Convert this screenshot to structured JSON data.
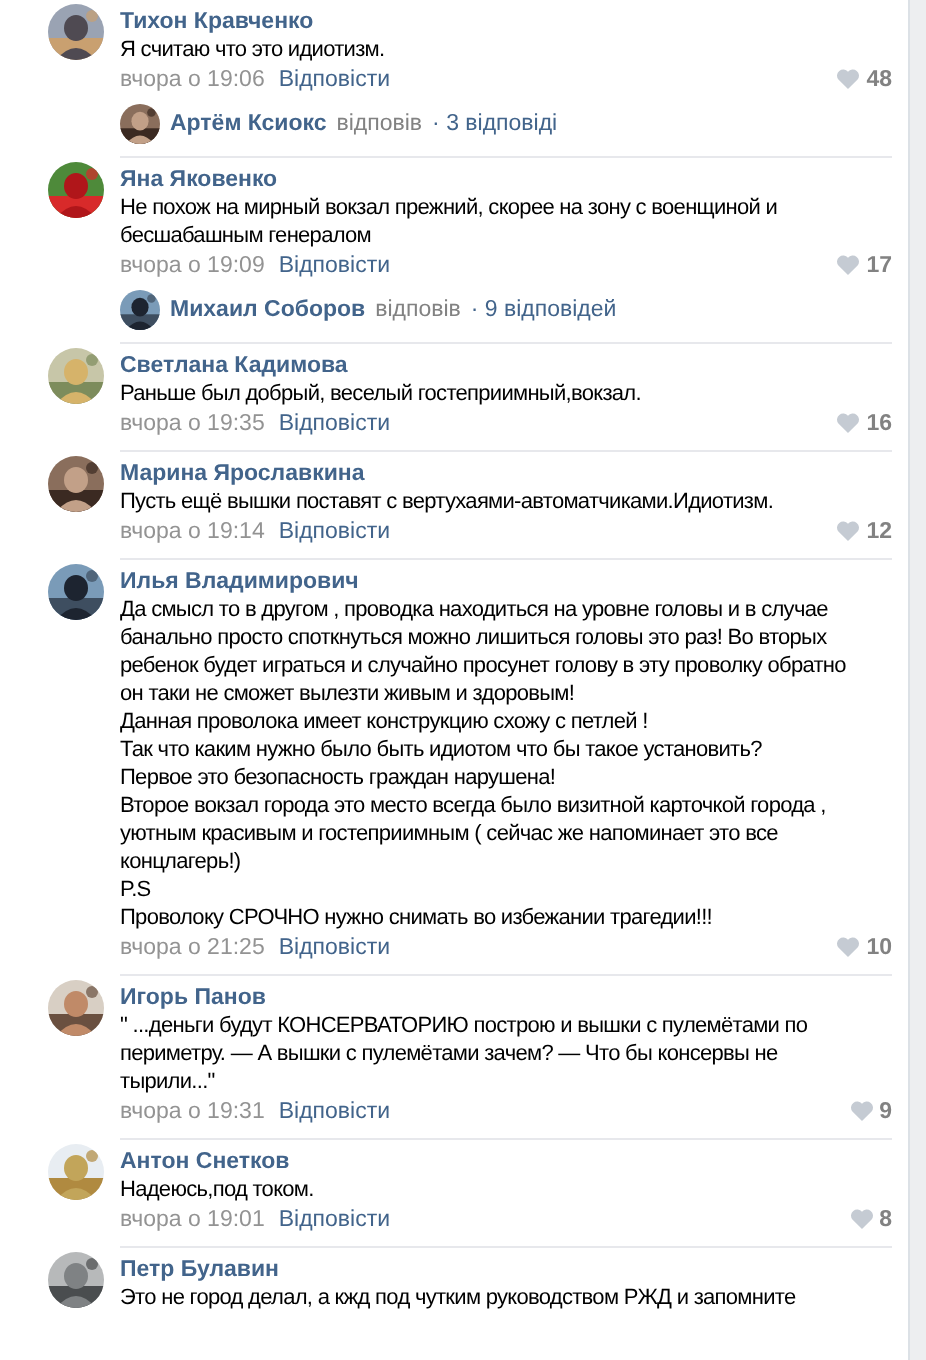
{
  "comments": [
    {
      "author": "Тихон Кравченко",
      "text": "Я считаю что это идиотизм.",
      "time": "вчора о 19:06",
      "reply": "Відповісти",
      "likes": "48",
      "thread": {
        "author": "Артём Ксиокс",
        "verb": "відповів",
        "count": "· 3 відповіді"
      }
    },
    {
      "author": "Яна Яковенко",
      "text": "Не похож на мирный вокзал прежний, скорее на зону с военщиной и\nбесшабашным генералом",
      "time": "вчора о 19:09",
      "reply": "Відповісти",
      "likes": "17",
      "thread": {
        "author": "Михаил Соборов",
        "verb": "відповів",
        "count": "· 9 відповідей"
      }
    },
    {
      "author": "Светлана Кадимова",
      "text": "Раньше был добрый, веселый гостеприимный,вокзал.",
      "time": "вчора о 19:35",
      "reply": "Відповісти",
      "likes": "16"
    },
    {
      "author": "Марина Ярославкина",
      "text": "Пусть ещё вышки поставят с вертухаями-автоматчиками.Идиотизм.",
      "time": "вчора о 19:14",
      "reply": "Відповісти",
      "likes": "12"
    },
    {
      "author": "Илья Владимирович",
      "text": "Да смысл то в другом , проводка находиться на уровне головы и в случае\nбанально просто споткнуться можно лишиться головы это раз! Во вторых\nребенок будет играться и случайно просунет голову в эту проволку обратно\nон таки не сможет вылезти живым и здоровым!\nДанная проволока имеет конструкцию схожу с петлей !\nТак что каким нужно было быть идиотом что бы такое установить?\nПервое это безопасность граждан нарушена!\nВторое вокзал города это место всегда было визитной карточкой города ,\nуютным красивым и гостеприимным ( сейчас же напоминает это все\nконцлагерь!)\nP.S\nПроволоку СРОЧНО нужно снимать во избежании трагедии!!!",
      "time": "вчора о 21:25",
      "reply": "Відповісти",
      "likes": "10"
    },
    {
      "author": "Игорь Панов",
      "text": "\" ...деньги будут КОНСЕРВАТОРИЮ построю и вышки с пулемётами по\nпериметру. — А вышки с пулемётами зачем? — Что бы консервы не\nтырили...\"",
      "time": "вчора о 19:31",
      "reply": "Відповісти",
      "likes": "9"
    },
    {
      "author": "Антон Снетков",
      "text": "Надеюсь,под током.",
      "time": "вчора о 19:01",
      "reply": "Відповісти",
      "likes": "8"
    },
    {
      "author": "Петр Булавин",
      "text": "Это не город делал, а кжд под чутким руководством РЖД и запомните"
    }
  ]
}
